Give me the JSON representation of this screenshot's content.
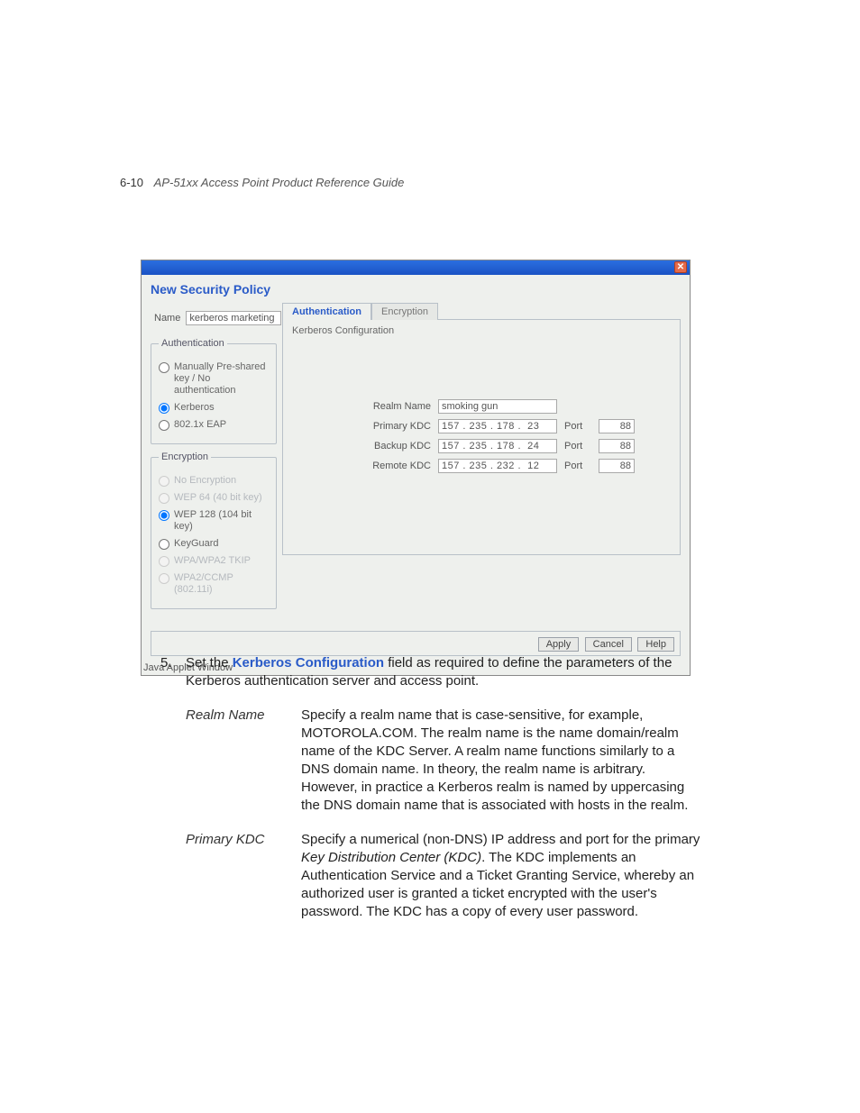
{
  "header": {
    "page_num": "6-10",
    "guide_title": "AP-51xx Access Point Product Reference Guide"
  },
  "window": {
    "title": "New Security Policy",
    "close_glyph": "✕",
    "name_label": "Name",
    "name_value": "kerberos marketing",
    "auth_legend": "Authentication",
    "auth_options": {
      "psk": "Manually Pre-shared key / No authentication",
      "kerberos": "Kerberos",
      "eap": "802.1x EAP"
    },
    "enc_legend": "Encryption",
    "enc_options": {
      "none": "No Encryption",
      "wep64": "WEP 64 (40 bit key)",
      "wep128": "WEP 128 (104 bit key)",
      "keyguard": "KeyGuard",
      "tkip": "WPA/WPA2 TKIP",
      "ccmp": "WPA2/CCMP (802.11i)"
    },
    "tabs": {
      "auth": "Authentication",
      "enc": "Encryption"
    },
    "cfg": {
      "title": "Kerberos Configuration",
      "realm_label": "Realm Name",
      "realm_value": "smoking gun",
      "primary_label": "Primary KDC",
      "primary_ip": "157 . 235 . 178 .  23",
      "backup_label": "Backup KDC",
      "backup_ip": "157 . 235 . 178 .  24",
      "remote_label": "Remote KDC",
      "remote_ip": "157 . 235 . 232 .  12",
      "port_label": "Port",
      "port_primary": "88",
      "port_backup": "88",
      "port_remote": "88"
    },
    "buttons": {
      "apply": "Apply",
      "cancel": "Cancel",
      "help": "Help"
    },
    "java_label": "Java Applet Window"
  },
  "step": {
    "num": "5.",
    "pre": "Set the ",
    "bold": "Kerberos Configuration",
    "post": " field as required to define the parameters of the Kerberos authentication server and access point."
  },
  "defs": {
    "realm": {
      "term": "Realm Name",
      "desc": "Specify a realm name that is case-sensitive, for example, MOTOROLA.COM. The realm name is the name domain/realm name of the KDC Server. A realm name functions similarly to a DNS domain name. In theory, the realm name is arbitrary. However, in practice a Kerberos realm is named by uppercasing the DNS domain name that is associated with hosts in the realm."
    },
    "primary": {
      "term": "Primary KDC",
      "pre": "Specify a numerical (non-DNS) IP address and port for the primary ",
      "ital": "Key Distribution Center (KDC)",
      "post": ". The KDC implements an Authentication Service and a Ticket Granting Service, whereby an authorized user is granted a ticket encrypted with the user's password. The KDC has a copy of every user password."
    }
  }
}
